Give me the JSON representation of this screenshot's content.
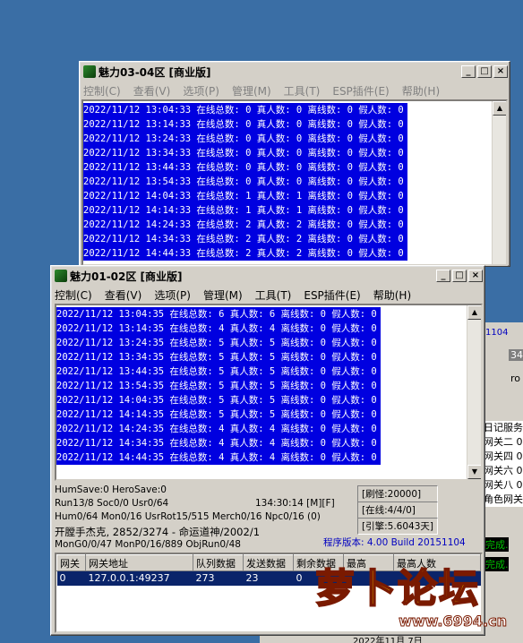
{
  "window_back": {
    "title": "魅力03-04区 [商业版]",
    "menu": [
      "控制(C)",
      "查看(V)",
      "选项(P)",
      "管理(M)",
      "工具(T)",
      "ESP插件(E)",
      "帮助(H)"
    ],
    "log": [
      "2022/11/12 13:04:33 在线总数: 0 真人数: 0 离线数: 0 假人数: 0",
      "2022/11/12 13:14:33 在线总数: 0 真人数: 0 离线数: 0 假人数: 0",
      "2022/11/12 13:24:33 在线总数: 0 真人数: 0 离线数: 0 假人数: 0",
      "2022/11/12 13:34:33 在线总数: 0 真人数: 0 离线数: 0 假人数: 0",
      "2022/11/12 13:44:33 在线总数: 0 真人数: 0 离线数: 0 假人数: 0",
      "2022/11/12 13:54:33 在线总数: 0 真人数: 0 离线数: 0 假人数: 0",
      "2022/11/12 14:04:33 在线总数: 1 真人数: 1 离线数: 0 假人数: 0",
      "2022/11/12 14:14:33 在线总数: 1 真人数: 1 离线数: 0 假人数: 0",
      "2022/11/12 14:24:33 在线总数: 2 真人数: 2 离线数: 0 假人数: 0",
      "2022/11/12 14:34:33 在线总数: 2 真人数: 2 离线数: 0 假人数: 0",
      "2022/11/12 14:44:33 在线总数: 2 真人数: 2 离线数: 0 假人数: 0"
    ]
  },
  "window_front": {
    "title": "魅力01-02区 [商业版]",
    "menu": [
      "控制(C)",
      "查看(V)",
      "选项(P)",
      "管理(M)",
      "工具(T)",
      "ESP插件(E)",
      "帮助(H)"
    ],
    "log": [
      "2022/11/12 13:04:35 在线总数: 6 真人数: 6 离线数: 0 假人数: 0",
      "2022/11/12 13:14:35 在线总数: 4 真人数: 4 离线数: 0 假人数: 0",
      "2022/11/12 13:24:35 在线总数: 5 真人数: 5 离线数: 0 假人数: 0",
      "2022/11/12 13:34:35 在线总数: 5 真人数: 5 离线数: 0 假人数: 0",
      "2022/11/12 13:44:35 在线总数: 5 真人数: 5 离线数: 0 假人数: 0",
      "2022/11/12 13:54:35 在线总数: 5 真人数: 5 离线数: 0 假人数: 0",
      "2022/11/12 14:04:35 在线总数: 5 真人数: 5 离线数: 0 假人数: 0",
      "2022/11/12 14:14:35 在线总数: 5 真人数: 5 离线数: 0 假人数: 0",
      "2022/11/12 14:24:35 在线总数: 4 真人数: 4 离线数: 0 假人数: 0",
      "2022/11/12 14:34:35 在线总数: 4 真人数: 4 离线数: 0 假人数: 0",
      "2022/11/12 14:44:35 在线总数: 4 真人数: 4 离线数: 0 假人数: 0"
    ],
    "status": {
      "line1": "HumSave:0 HeroSave:0",
      "line2": "Run13/8 Soc0/0 Usr0/64",
      "line2_right": "134:30:14 [M][F]",
      "line3": "Hum0/64 Mon0/16 UsrRot15/515 Merch0/16 Npc0/16 (0)",
      "line4": "开膛手杰克, 2852/3274 - 命运道神/2002/1",
      "line5": "MonG0/0/47 MonP0/16/889 ObjRun0/48",
      "refresh": "[刷怪:20000]",
      "online": "[在线:4/4/0]",
      "expire": "[引擎:5.6043天]",
      "version": "程序版本: 4.00 Build 20151104"
    },
    "gateway_table": {
      "headers": [
        "网关",
        "网关地址",
        "队列数据",
        "发送数据",
        "剩余数据",
        "最高",
        "最高人数"
      ],
      "rows": [
        [
          "0",
          "127.0.0.1:49237",
          "273",
          "23",
          "0",
          "",
          ""
        ]
      ]
    }
  },
  "right_partial": {
    "lines": [
      "日记服务",
      "网关二 0",
      "网关四 0",
      "网关六 0",
      "网关八 0",
      "角色网关"
    ],
    "text_1104": "1104",
    "text_34": "34",
    "text_ro": "ro",
    "done1": "完成.",
    "done2": "完成."
  },
  "bottom_date": "2022年11月 7日",
  "watermark": {
    "text": "萝卜论坛",
    "url": "www.6994.cn"
  }
}
